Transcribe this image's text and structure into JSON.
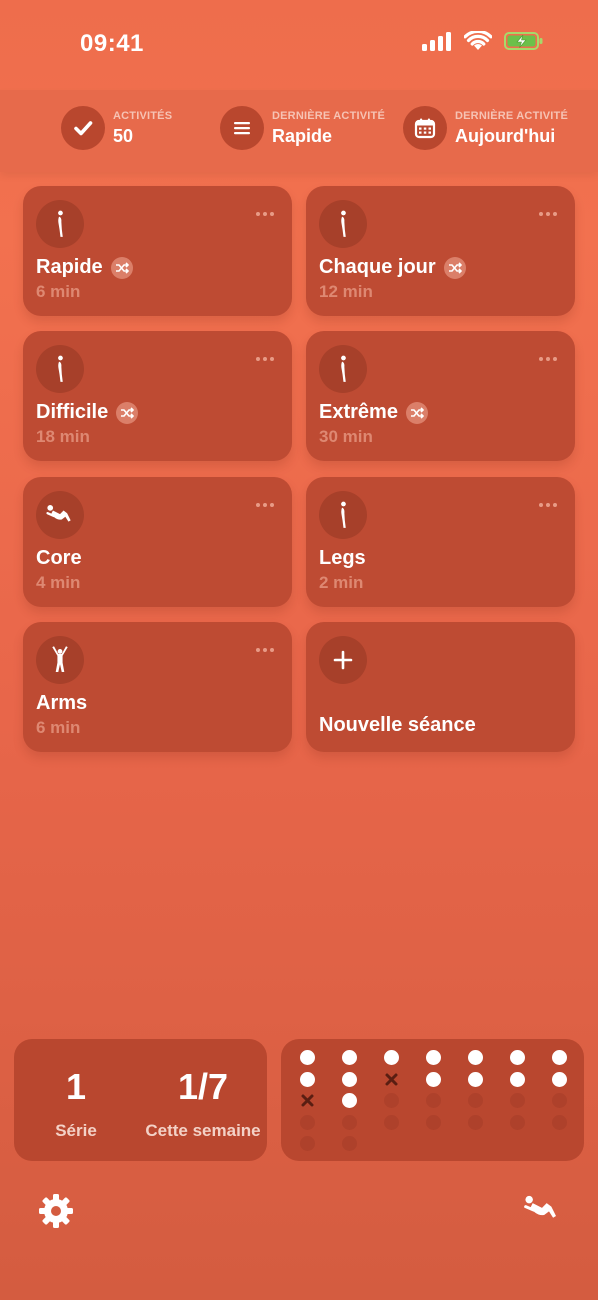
{
  "status_bar": {
    "time": "09:41"
  },
  "stats": [
    {
      "label": "ACTIVITÉS",
      "value": "50",
      "icon": "checkmark-icon"
    },
    {
      "label": "DERNIÈRE ACTIVITÉ",
      "value": "Rapide",
      "icon": "list-icon"
    },
    {
      "label": "DERNIÈRE ACTIVITÉ",
      "value": "Aujourd'hui",
      "icon": "calendar-icon"
    }
  ],
  "workouts": [
    {
      "title": "Rapide",
      "duration": "6 min",
      "shuffle": true,
      "icon": "standing-figure-icon"
    },
    {
      "title": "Chaque jour",
      "duration": "12 min",
      "shuffle": true,
      "icon": "standing-figure-icon"
    },
    {
      "title": "Difficile",
      "duration": "18 min",
      "shuffle": true,
      "icon": "standing-figure-icon"
    },
    {
      "title": "Extrême",
      "duration": "30 min",
      "shuffle": true,
      "icon": "standing-figure-icon"
    },
    {
      "title": "Core",
      "duration": "4 min",
      "shuffle": false,
      "icon": "situp-figure-icon"
    },
    {
      "title": "Legs",
      "duration": "2 min",
      "shuffle": false,
      "icon": "standing-figure-icon"
    },
    {
      "title": "Arms",
      "duration": "6 min",
      "shuffle": false,
      "icon": "arms-up-figure-icon"
    }
  ],
  "new_session": {
    "label": "Nouvelle séance",
    "icon": "plus-icon"
  },
  "streak": {
    "series_value": "1",
    "series_label": "Série",
    "week_value": "1/7",
    "week_label": "Cette semaine"
  },
  "activity_grid": {
    "columns": 7,
    "rows": [
      [
        "on",
        "on",
        "on",
        "on",
        "on",
        "on",
        "on"
      ],
      [
        "on",
        "on",
        "miss",
        "on",
        "on",
        "on",
        "on"
      ],
      [
        "miss",
        "on",
        "off",
        "off",
        "off",
        "off",
        "off"
      ],
      [
        "off",
        "off",
        "off",
        "off",
        "off",
        "off",
        "off"
      ],
      [
        "off",
        "off"
      ]
    ]
  },
  "toolbar": {
    "settings_icon": "gear-icon",
    "workout_icon": "situp-figure-icon"
  },
  "colors": {
    "accent": "#EE6D4C",
    "card": "#BE4B33",
    "panel": "#B9472F"
  }
}
